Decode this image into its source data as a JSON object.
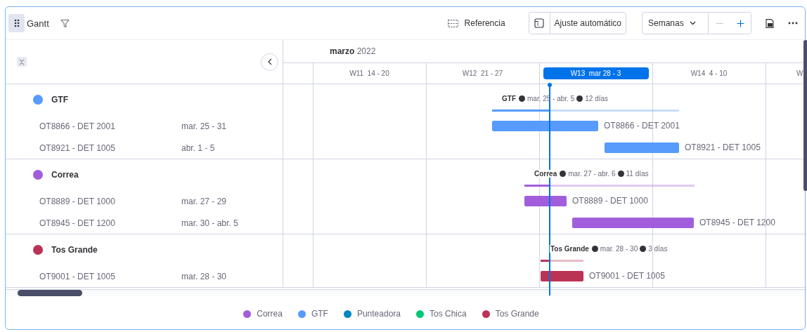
{
  "toolbar": {
    "title": "Gantt",
    "reference": "Referencia",
    "autofit": "Ajuste automático",
    "scale": "Semanas",
    "zoom_out": {
      "disabled": true
    },
    "zoom_in": {
      "disabled": false
    }
  },
  "timeline": {
    "month": "**marzo** 2022",
    "weeks": [
      {
        "label": "W11  14 - 20",
        "selected": false
      },
      {
        "label": "W12  21 - 27",
        "selected": false
      },
      {
        "label": "W13  mar 28 - 3",
        "selected": true
      },
      {
        "label": "W14  4 - 10",
        "selected": false
      },
      {
        "label": "W",
        "selected": false
      }
    ]
  },
  "groups": [
    {
      "name": "GTF",
      "color": "#579bfc",
      "summary": {
        "name": "GTF",
        "dates": "mar. 25 - abr. 5",
        "duration": "12 días"
      },
      "items": [
        {
          "name": "OT8866 - DET 2001",
          "dates": "mar. 25 - 31",
          "bar_label": "OT8866 - DET 2001"
        },
        {
          "name": "OT8921 - DET 1005",
          "dates": "abr. 1 - 5",
          "bar_label": "OT8921 - DET 1005"
        }
      ]
    },
    {
      "name": "Correa",
      "color": "#a25ddc",
      "summary": {
        "name": "Correa",
        "dates": "mar. 27 - abr. 6",
        "duration": "11 días"
      },
      "items": [
        {
          "name": "OT8889 - DET 1000",
          "dates": "mar. 27 - 29",
          "bar_label": "OT8889 - DET 1000"
        },
        {
          "name": "OT8945 - DET 1200",
          "dates": "mar. 30 - abr. 5",
          "bar_label": "OT8945 - DET 1200"
        }
      ]
    },
    {
      "name": "Tos Grande",
      "color": "#bb3354",
      "summary": {
        "name": "Tos Grande",
        "dates": "mar. 28 - 30",
        "duration": "3 días"
      },
      "items": [
        {
          "name": "OT9001 - DET 1005",
          "dates": "mar. 28 - 30",
          "bar_label": "OT9001 - DET 1005"
        }
      ]
    }
  ],
  "legend": [
    {
      "label": "Correa",
      "color": "#a25ddc"
    },
    {
      "label": "GTF",
      "color": "#579bfc"
    },
    {
      "label": "Punteadora",
      "color": "#0086c0"
    },
    {
      "label": "Tos Chica",
      "color": "#00c875"
    },
    {
      "label": "Tos Grande",
      "color": "#bb3354"
    }
  ]
}
